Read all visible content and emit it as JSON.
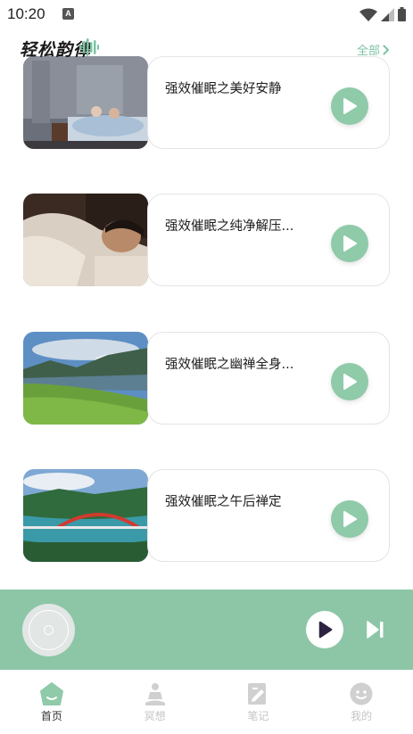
{
  "status_bar": {
    "time": "10:20",
    "notification_icon": "a-letter-icon",
    "wifi_icon": "wifi-icon",
    "signal_icon": "signal-icon",
    "battery_icon": "battery-icon"
  },
  "header": {
    "app_title": "轻松韵律",
    "logo_icon": "sound-wave-icon",
    "all_label": "全部"
  },
  "tracks": [
    {
      "title": "强效催眠之美好安静",
      "thumb": "bedroom-photo"
    },
    {
      "title": "强效催眠之纯净解压...",
      "thumb": "sleeping-person-photo"
    },
    {
      "title": "强效催眠之幽禅全身...",
      "thumb": "lake-mountain-photo"
    },
    {
      "title": "强效催眠之午后禅定",
      "thumb": "bridge-river-photo"
    }
  ],
  "player": {
    "disc_icon": "disc-icon",
    "play_icon": "play-icon",
    "next_icon": "skip-next-icon"
  },
  "bottom_nav": [
    {
      "label": "首页",
      "icon": "home-icon",
      "active": true
    },
    {
      "label": "冥想",
      "icon": "meditation-icon",
      "active": false
    },
    {
      "label": "笔记",
      "icon": "note-icon",
      "active": false
    },
    {
      "label": "我的",
      "icon": "profile-icon",
      "active": false
    }
  ],
  "colors": {
    "accent": "#8dc6a7",
    "play_button": "#8fcaa9",
    "link": "#7cc4a4",
    "inactive_nav": "#c4c4c4"
  }
}
